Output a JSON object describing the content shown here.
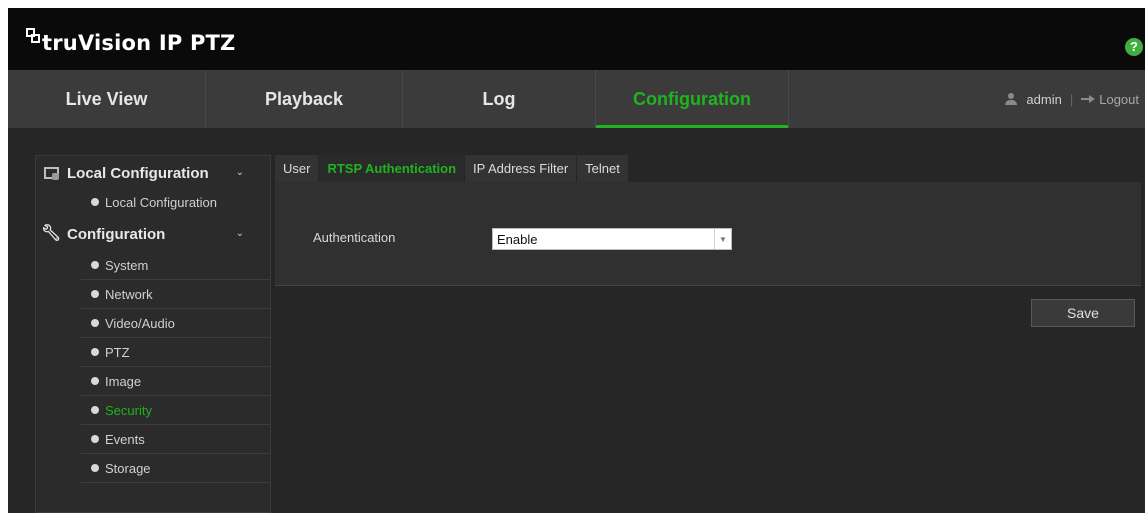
{
  "header": {
    "brand": "truVision",
    "product": "IP PTZ",
    "help_label": "?"
  },
  "nav": {
    "tabs": [
      {
        "label": "Live View"
      },
      {
        "label": "Playback"
      },
      {
        "label": "Log"
      },
      {
        "label": "Configuration",
        "active": true
      }
    ],
    "user": "admin",
    "separator": "|",
    "logout": "Logout"
  },
  "sidebar": {
    "groups": [
      {
        "label": "Local Configuration",
        "icon": "monitor-icon",
        "chevron": "⌄",
        "items": [
          "Local Configuration"
        ]
      },
      {
        "label": "Configuration",
        "icon": "wrench-icon",
        "chevron": "⌄",
        "items": [
          "System",
          "Network",
          "Video/Audio",
          "PTZ",
          "Image",
          "Security",
          "Events",
          "Storage"
        ],
        "active_item": "Security"
      }
    ]
  },
  "content": {
    "tabs": [
      {
        "label": "User"
      },
      {
        "label": "RTSP Authentication",
        "active": true
      },
      {
        "label": "IP Address Filter"
      },
      {
        "label": "Telnet"
      }
    ],
    "authentication_label": "Authentication",
    "authentication_value": "Enable",
    "save_label": "Save"
  },
  "colors": {
    "accent": "#1fb41f",
    "header_bg": "#0a0a0a",
    "nav_bg": "#3b3b3b",
    "page_bg": "#262626",
    "help_icon": "#3fae3f"
  }
}
